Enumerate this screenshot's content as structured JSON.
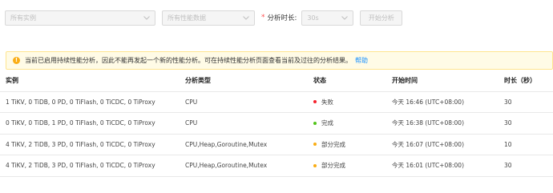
{
  "toolbar": {
    "instance_placeholder": "所有实例",
    "data_placeholder": "所有性能数据",
    "required_mark": "*",
    "duration_label": "分析时长:",
    "duration_value": "30s",
    "start_button": "开始分析"
  },
  "alert": {
    "message": "当前已启用持续性能分析，因此不能再发起一个新的性能分析。可在持续性能分析页面查看当前及过往的分析结果。",
    "link": "帮助"
  },
  "table": {
    "headers": [
      "实例",
      "分析类型",
      "状态",
      "开始时间",
      "时长（秒）"
    ],
    "rows": [
      {
        "instance": "1 TiKV, 0 TiDB, 0 PD, 0 TiFlash, 0 TiCDC, 0 TiProxy",
        "type": "CPU",
        "status": "失败",
        "status_color": "#f5222d",
        "start": "今天 16:46 (UTC+08:00)",
        "duration": "30"
      },
      {
        "instance": "0 TiKV, 0 TiDB, 1 PD, 0 TiFlash, 0 TiCDC, 0 TiProxy",
        "type": "CPU",
        "status": "完成",
        "status_color": "#52c41a",
        "start": "今天 16:38 (UTC+08:00)",
        "duration": "30"
      },
      {
        "instance": "4 TiKV, 2 TiDB, 3 PD, 0 TiFlash, 0 TiCDC, 0 TiProxy",
        "type": "CPU,Heap,Goroutine,Mutex",
        "status": "部分完成",
        "status_color": "#faad14",
        "start": "今天 16:07 (UTC+08:00)",
        "duration": "10"
      },
      {
        "instance": "4 TiKV, 2 TiDB, 3 PD, 0 TiFlash, 0 TiCDC, 0 TiProxy",
        "type": "CPU,Heap,Goroutine,Mutex",
        "status": "部分完成",
        "status_color": "#faad14",
        "start": "今天 16:01 (UTC+08:00)",
        "duration": "30"
      }
    ]
  }
}
